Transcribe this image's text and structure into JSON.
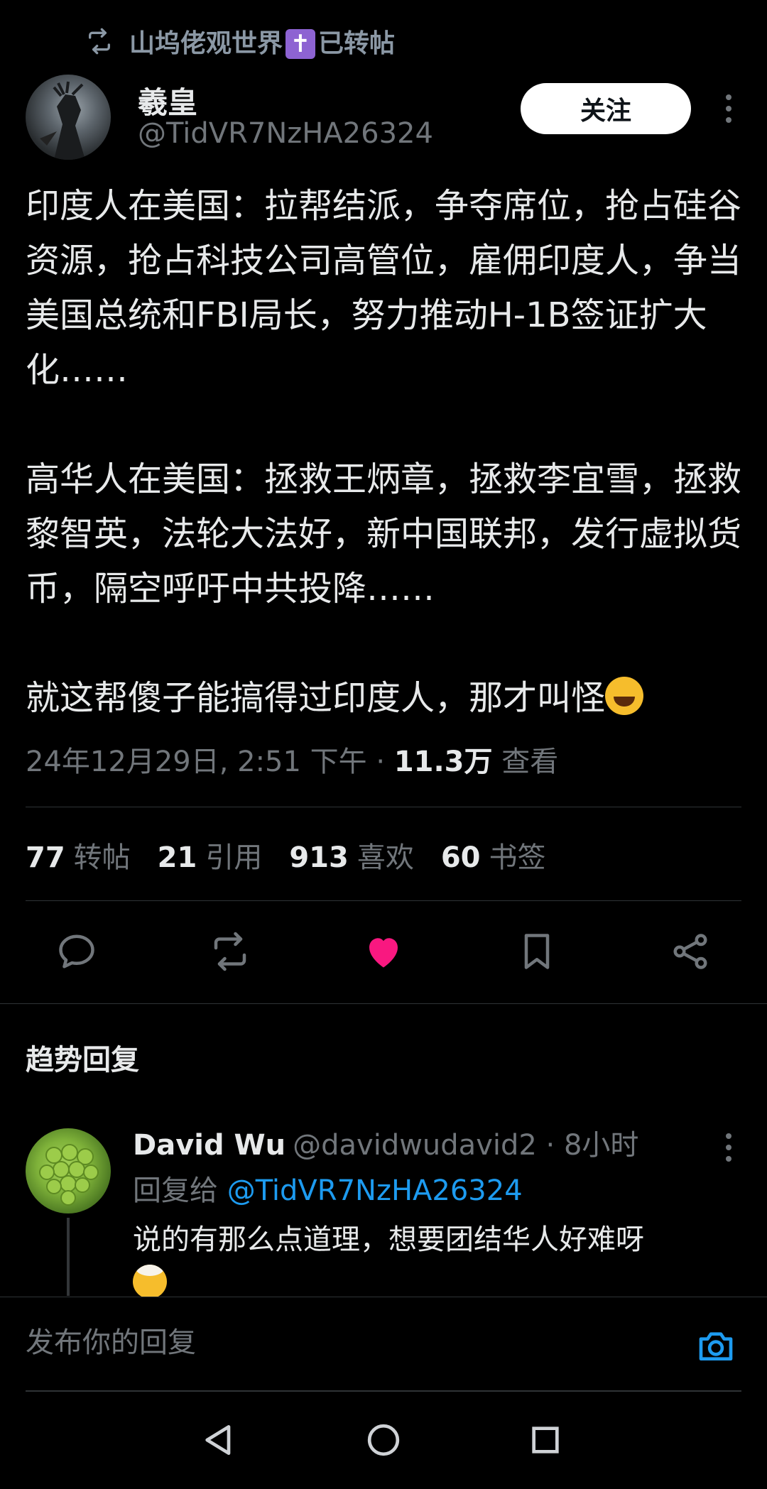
{
  "repost": {
    "user_before": "山坞佬观世界",
    "user_after": "已转帖",
    "cross_glyph": "✝",
    "icon": "repost-icon"
  },
  "author": {
    "name": "羲皇",
    "handle": "@TidVR7NzHA26324",
    "follow_label": "关注"
  },
  "post": {
    "paragraphs": [
      "印度人在美国：拉帮结派，争夺席位，抢占硅谷资源，抢占科技公司高管位，雇佣印度人，争当美国总统和FBI局长，努力推动H-1B签证扩大化……",
      "高华人在美国：拯救王炳章，拯救李宜雪，拯救黎智英，法轮大法好，新中国联邦，发行虚拟货币，隔空呼吁中共投降……",
      "就这帮傻子能搞得过印度人，那才叫怪"
    ],
    "ending_emoji": "rolling-on-floor-laughing-emoji"
  },
  "meta": {
    "datetime": "24年12月29日, 2:51 下午 · ",
    "views": "11.3万",
    "views_label": " 查看"
  },
  "stats": [
    {
      "num": "77",
      "label": "转帖"
    },
    {
      "num": "21",
      "label": "引用"
    },
    {
      "num": "913",
      "label": "喜欢"
    },
    {
      "num": "60",
      "label": "书签"
    }
  ],
  "actions": {
    "reply_icon": "comment-icon",
    "repost_icon": "repost-icon",
    "like_icon": "heart-filled-icon",
    "bookmark_icon": "bookmark-icon",
    "share_icon": "share-icon",
    "like_color": "#f91880"
  },
  "trending": {
    "title": "趋势回复"
  },
  "reply": {
    "name": "David Wu",
    "handle": "@davidwudavid2",
    "time": " · 8小时",
    "reply_to_label": "回复给 ",
    "reply_to_handle": "@TidVR7NzHA26324",
    "text": "说的有那么点道理，想要团结华人好难呀",
    "emoji": "exploding-head-emoji"
  },
  "composer": {
    "placeholder": "发布你的回复",
    "camera_icon": "camera-icon",
    "accent": "#1d9bf0"
  },
  "navbar": {
    "back_icon": "back-triangle-icon",
    "home_icon": "home-circle-icon",
    "recents_icon": "recents-square-icon"
  }
}
